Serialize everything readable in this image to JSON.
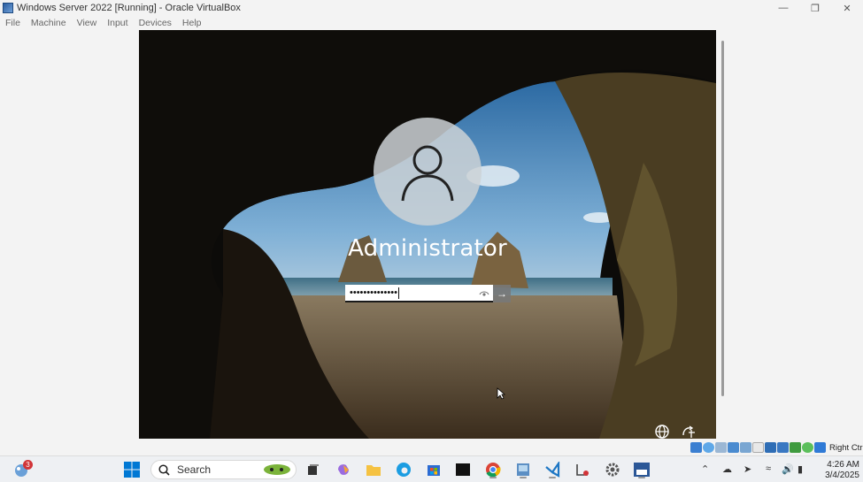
{
  "window": {
    "title": "Windows Server 2022 [Running] - Oracle VirtualBox",
    "controls": [
      "minimize",
      "restore",
      "close"
    ]
  },
  "menu": [
    "File",
    "Machine",
    "View",
    "Input",
    "Devices",
    "Help"
  ],
  "login": {
    "username": "Administrator",
    "password_mask": "••••••••••••••",
    "submit_icon": "arrow-right-icon",
    "reveal_icon": "eye-icon"
  },
  "vm_corner_icons": [
    "globe-icon",
    "accessibility-icon"
  ],
  "statusbar": {
    "host_key": "Right Ctr"
  },
  "taskbar": {
    "notification_count": "3",
    "search_label": "Search",
    "time": "4:26 AM",
    "date": "3/4/2025"
  },
  "colors": {
    "accent": "#0078d4",
    "titlebar_bg": "#f3f3f3",
    "taskbar_bg": "#eef0f3"
  }
}
